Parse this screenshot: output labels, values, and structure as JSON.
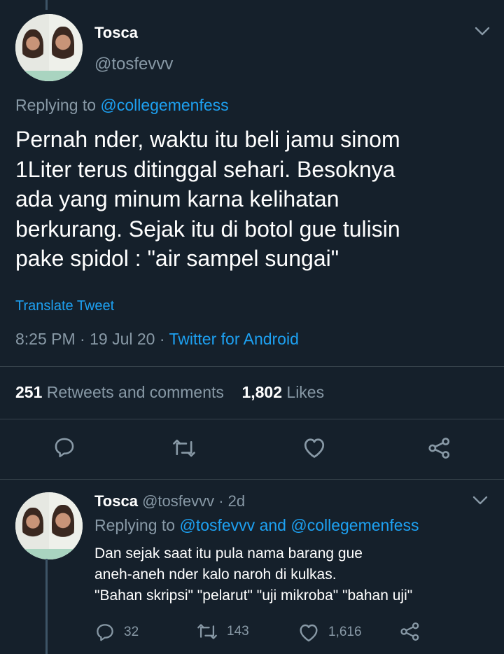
{
  "tweet": {
    "display_name": "Tosca",
    "handle": "@tosfevvv",
    "replying_prefix": "Replying to ",
    "replying_to": "@collegemenfess",
    "text_lines": [
      "Pernah nder, waktu itu beli jamu sinom",
      "1Liter terus ditinggal sehari. Besoknya",
      "ada yang minum karna kelihatan",
      "berkurang. Sejak itu di botol gue tulisin",
      "pake spidol : \"air sampel sungai\""
    ],
    "translate_label": "Translate Tweet",
    "time": "8:25 PM",
    "date": "19 Jul 20",
    "separator": "·",
    "source": "Twitter for Android",
    "retweets_count": "251",
    "retweets_label": "Retweets and comments",
    "likes_count": "1,802",
    "likes_label": "Likes"
  },
  "reply": {
    "display_name": "Tosca",
    "handle": "@tosfevvv",
    "age": "· 2d",
    "replying_prefix": "Replying to ",
    "replying_to_1": "@tosfevvv",
    "and_label": " and ",
    "replying_to_2": "@collegemenfess",
    "text_lines": [
      "Dan sejak saat itu pula nama barang gue",
      "aneh-aneh nder kalo naroh di kulkas.",
      "\"Bahan skripsi\" \"pelarut\" \"uji mikroba\" \"bahan uji\""
    ],
    "comments_count": "32",
    "retweets_count": "143",
    "likes_count": "1,616"
  },
  "icons": {
    "chevron": "chevron-down-icon",
    "comment": "comment-icon",
    "retweet": "retweet-icon",
    "like": "heart-icon",
    "share": "share-icon"
  },
  "colors": {
    "background": "#15202b",
    "accent": "#1da1f2",
    "secondary_text": "#8899a6",
    "divider": "#38444d"
  }
}
